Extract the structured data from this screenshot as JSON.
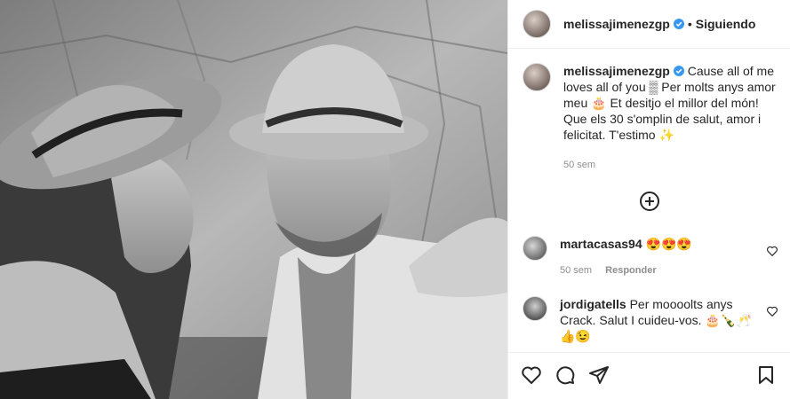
{
  "post": {
    "author": "melissajimenezgp",
    "follow_status": "Siguiendo",
    "separator": "•",
    "caption": {
      "author": "melissajimenezgp",
      "text": "Cause all of me loves all of you ▒ Per molts anys amor meu 🎂 Et desitjo el millor del món! Que els 30 s'omplin de salut, amor i felicitat. T'estimo ✨",
      "timestamp": "50 sem"
    },
    "comments": [
      {
        "user": "martacasas94",
        "text": "😍😍😍",
        "timestamp": "50 sem",
        "reply_label": "Responder"
      },
      {
        "user": "jordigatells",
        "text": "Per moooolts anys Crack. Salut I cuideu-vos. 🎂🍾🥂👍😉"
      }
    ]
  },
  "icons": {
    "verified": "verified-badge-icon",
    "load_more": "plus-circle-icon",
    "like": "heart-icon",
    "comment": "comment-icon",
    "share": "paper-plane-icon",
    "save": "bookmark-icon"
  },
  "colors": {
    "verified_blue": "#3897f0",
    "secondary_text": "#8e8e8e",
    "divider": "#efefef"
  }
}
